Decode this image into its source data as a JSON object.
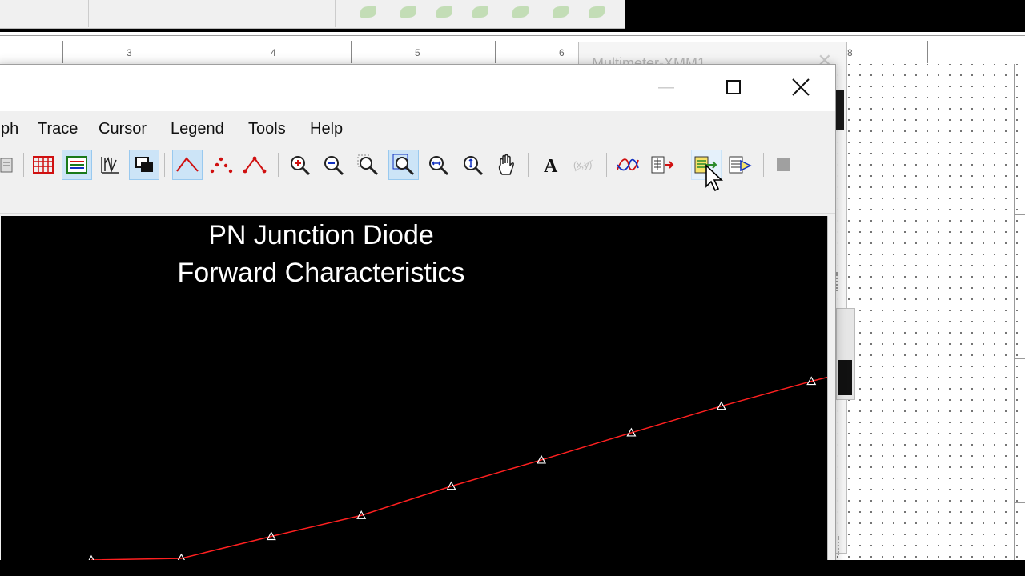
{
  "ruler": {
    "labels": [
      "3",
      "4",
      "5",
      "6",
      "8"
    ]
  },
  "multimeter": {
    "title": "Multimeter-XMM1"
  },
  "grapher": {
    "menu": [
      "ph",
      "Trace",
      "Cursor",
      "Legend",
      "Tools",
      "Help"
    ],
    "toolbar_icons": [
      "copy-icon",
      "grid-icon",
      "legend-icon",
      "selected-icon",
      "overlay-icon",
      "lines-icon",
      "markers-icon",
      "lines-markers-icon",
      "zoom-in-icon",
      "zoom-out-icon",
      "zoom-area-icon",
      "zoom-full-icon",
      "zoom-x-icon",
      "zoom-y-icon",
      "pan-icon",
      "text-icon",
      "cursor-label-icon",
      "trace-icon",
      "export-excel-icon",
      "export-labview-icon",
      "export-more-icon",
      "stop-icon"
    ]
  },
  "plot": {
    "title_line1": "PN Junction Diode",
    "title_line2": "Forward Characteristics"
  },
  "colors": {
    "trace": "#ff2020",
    "plot_bg": "#000000",
    "active_button": "#cce4f7"
  },
  "chart_data": {
    "type": "line",
    "title": "PN Junction Diode Forward Characteristics",
    "x": [
      0,
      1,
      2,
      3,
      4,
      5,
      6,
      7,
      8,
      9
    ],
    "series": [
      {
        "values": [
          0.0,
          0.05,
          0.72,
          1.36,
          2.25,
          3.05,
          3.88,
          4.69,
          5.45,
          6.13
        ]
      }
    ]
  }
}
